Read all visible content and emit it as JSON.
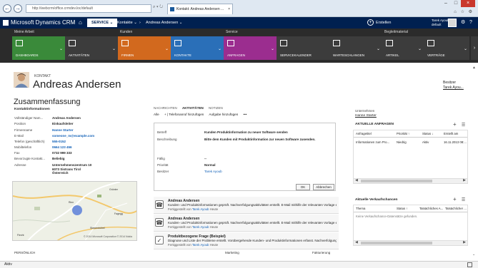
{
  "browser": {
    "url": "http://webcrm/office.crmdev.loc/default",
    "tab_title": "Kontakt: Andreas Andersen ...",
    "back_glyph": "←",
    "forward_glyph": "→",
    "addr_tools": "⌕ ▾ ↻",
    "tab_close": "×",
    "win_min": "–",
    "win_max": "□",
    "win_close": "×",
    "tool_icons": "⌂ ☆ ⚙"
  },
  "crm_nav": {
    "logo": "Microsoft Dynamics CRM",
    "logo_chev": "⌄",
    "home_glyph": "⌂",
    "area": "SERVICE",
    "area_chev": "⌄",
    "crumb_1": "Kontakte",
    "crumb_1_chev": "⌄",
    "sep": "›",
    "crumb_2": "Andreas Andersen",
    "crumb_2_chev": "⌄",
    "create_glyph": "+",
    "create": "Erstellen",
    "user_name": "Tarek Ayoub",
    "user_org": "default",
    "settings_glyph": "⚙",
    "help_glyph": "?"
  },
  "sitemap": {
    "groups": [
      "Meine Arbeit",
      "Kunden",
      "Service",
      "Begleitmaterial"
    ],
    "tiles": [
      {
        "label": "Dashboards",
        "color": "#3a8a3a"
      },
      {
        "label": "Aktivitäten",
        "color": "#3c3c3c"
      },
      {
        "label": "Firmen",
        "color": "#d2691e"
      },
      {
        "label": "Kontakte",
        "color": "#2a6fb8"
      },
      {
        "label": "Anfragen",
        "color": "#9b2d8f"
      },
      {
        "label": "Servicekalender",
        "color": "#3c3c3c"
      },
      {
        "label": "Warteschlangen",
        "color": "#3c3c3c"
      },
      {
        "label": "Artikel",
        "color": "#3c3c3c"
      },
      {
        "label": "Verträge",
        "color": "#3c3c3c"
      }
    ],
    "chevron": "⌄",
    "next_glyph": "›"
  },
  "header": {
    "entity": "KONTAKT",
    "name": "Andreas Andersen",
    "owner_label": "Besitzer",
    "owner_value": "Tarek Ayou..."
  },
  "summary": {
    "title": "Zusammenfassung",
    "contact_heading": "Kontaktinformationen",
    "fields": [
      {
        "k": "Vollständiger Nam...",
        "v": "Andreas Andersen"
      },
      {
        "k": "Position",
        "v": "Einkaufsleiter"
      },
      {
        "k": "Firmenname",
        "v": "Hanne Starter"
      },
      {
        "k": "E-Mail",
        "v": "someone_m@example.com"
      },
      {
        "k": "Telefon (geschäftlich)",
        "v": "555-0152"
      },
      {
        "k": "Mobiltelefon",
        "v": "0664 123 456"
      },
      {
        "k": "Fax",
        "v": "0732 999 333"
      },
      {
        "k": "Bevorzugte Kontakt...",
        "v": "Beliebig"
      },
      {
        "k": "Adresse",
        "v": "Unternehmenszentrum 10\n6073 Sistrans Tirol\nÖsterreich"
      }
    ],
    "map_copyright": "© 2014 Microsoft Corporation  © 2014 Nokia",
    "map_labels": [
      "Rinn",
      "Starkenbühel",
      "Fagegg",
      "Grünter",
      "Fiecht"
    ]
  },
  "activity": {
    "tabs": [
      "Nachrichten",
      "Aktivitäten",
      "Notizen"
    ],
    "sub_actions": [
      "Alle",
      "+ | Telefonanruf hinzufügen",
      "Aufgabe hinzufügen",
      "•••"
    ],
    "form": {
      "subject_label": "Betreff",
      "subject_value": "Kunden Produktinformation zu neuer Software senden",
      "desc_label": "Beschreibung",
      "desc_value": "Bitte dem Kunden mit Produktinformation zur neuen Software zusenden.",
      "due_label": "Fällig",
      "due_value": "--",
      "prio_label": "Priorität",
      "prio_value": "Normal",
      "owner_label": "Besitzer",
      "owner_value": "Tarek Ayoub",
      "ok": "OK",
      "cancel": "Abbrechen"
    },
    "items": [
      {
        "icon": "☎",
        "title": "Andreas Andersen",
        "desc": "Kunden- und Produktinformationen geprüft. Nachverfolgungsaktivitäten erstellt. E-Mail mithilfe der relevanten Vorlage er...",
        "meta_prefix": "Fertiggestellt von",
        "meta_user": "Tarek Ayoub",
        "meta_when": "Heute"
      },
      {
        "icon": "☎",
        "title": "Andreas Andersen",
        "desc": "Kunden- und Produktinformationen geprüft. Nachverfolgungsaktivitäten erstellt. E-Mail mithilfe der relevanten Vorlage er...",
        "meta_prefix": "Fertiggestellt von",
        "meta_user": "Tarek Ayoub",
        "meta_when": "Heute"
      },
      {
        "icon": "✓",
        "title": "Produktbezogene Frage (Beispiel)",
        "desc": "Diagnose und Liste der Probleme erstellt. Vorübergehende Kunden- und Produktinformationen erfasst. Nachverfolgungsa...",
        "meta_prefix": "Fertiggestellt von",
        "meta_user": "Tarek Ayoub",
        "meta_when": "Heute"
      }
    ]
  },
  "right": {
    "company_label": "Unternehmen",
    "company_value": "Hanne Starter",
    "cases_title": "AKTUELLE ANFRAGEN",
    "cases_headers": [
      "Anfragetitel",
      "Priorität ↑",
      "Status ↓",
      "Erstellt am"
    ],
    "cases_rows": [
      [
        "Informationen zum Pro...",
        "Niedrig",
        "Aktiv",
        "16.11.2013 08:..."
      ]
    ],
    "sales_title": "Aktuelle Verkaufschancen",
    "sales_headers": [
      "Thema",
      "Status ↑",
      "Tatsächliches A...",
      "Tatsächlicher ..."
    ],
    "sales_empty": "Keine Verkaufschance-Datensätze gefunden.",
    "add_glyph": "+",
    "list_glyph": "☰",
    "scroll_left": "◀",
    "scroll_right": "▶"
  },
  "footer": {
    "personal": "PERSÖNLICH",
    "marketing": "Marketing",
    "billing": "Fakturierung",
    "status": "Aktiv"
  },
  "page_scroll": {
    "up": "▲",
    "down": "⌄"
  }
}
